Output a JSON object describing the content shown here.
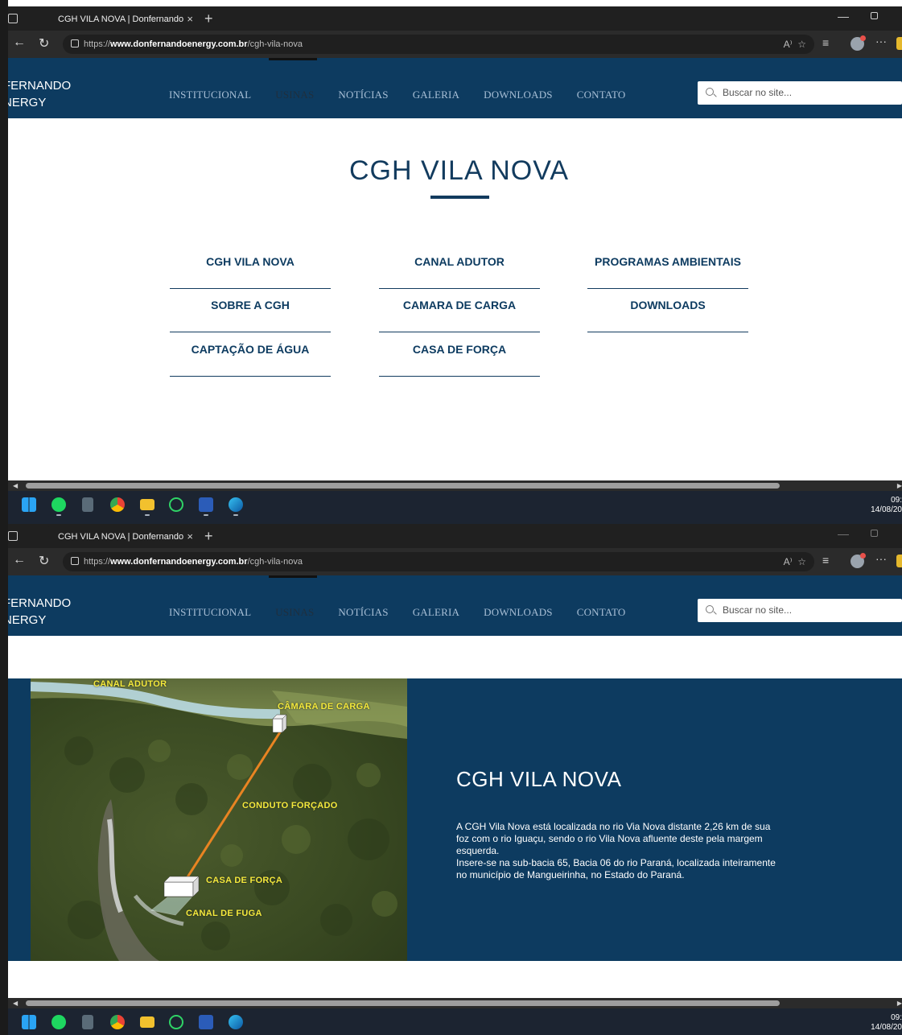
{
  "browser": {
    "tab_title": "CGH VILA NOVA | Donfernando",
    "tab_close": "×",
    "new_tab": "+",
    "url_prefix": "https://",
    "url_host": "www.donfernandoenergy.com.br",
    "url_path": "/cgh-vila-nova",
    "read_aloud": "A⁾",
    "more": "···"
  },
  "site": {
    "logo_line1": "FERNANDO",
    "logo_line2": "NERGY",
    "menu": [
      "INSTITUCIONAL",
      "USINAS",
      "NOTÍCIAS",
      "GALERIA",
      "DOWNLOADS",
      "CONTATO"
    ],
    "active_menu": "USINAS",
    "search_placeholder": "Buscar no site..."
  },
  "page1": {
    "title": "CGH VILA NOVA",
    "links": [
      "CGH VILA NOVA",
      "CANAL ADUTOR",
      "PROGRAMAS AMBIENTAIS",
      "SOBRE A CGH",
      "CAMARA DE CARGA",
      "DOWNLOADS",
      "CAPTAÇÃO DE ÁGUA",
      "CASA DE FORÇA"
    ]
  },
  "page2": {
    "photo_labels": {
      "canal_adutor": "CANAL ADUTOR",
      "camara_de_carga": "CÂMARA DE CARGA",
      "conduto_forcado": "CONDUTO FORÇADO",
      "casa_de_forca": "CASA DE FORÇA",
      "canal_de_fuga": "CANAL DE FUGA"
    },
    "title": "CGH VILA NOVA",
    "paragraph1": "A CGH Vila Nova está localizada no rio Via Nova distante 2,26 km de sua foz com o rio Iguaçu, sendo o rio Vila Nova afluente deste pela margem esquerda.",
    "paragraph2": "Insere-se na sub-bacia 65, Bacia 06 do rio Paraná, localizada inteiramente no município de Mangueirinha, no Estado do Paraná."
  },
  "taskbar": {
    "time": "09:",
    "date": "14/08/20"
  },
  "colors": {
    "brand_navy": "#0d3b60",
    "menu_text": "#a8bfd6",
    "photo_label": "#f4ea3b"
  },
  "icons": [
    "windows-icon",
    "spotify-icon",
    "calculator-icon",
    "chrome-icon",
    "file-explorer-icon",
    "whatsapp-icon",
    "word-icon",
    "edge-icon"
  ]
}
